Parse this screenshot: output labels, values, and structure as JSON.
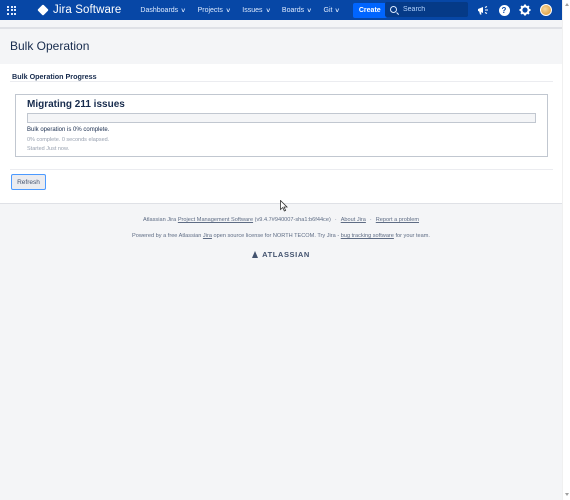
{
  "header": {
    "app_name": "Jira Software",
    "nav": [
      {
        "label": "Dashboards"
      },
      {
        "label": "Projects"
      },
      {
        "label": "Issues"
      },
      {
        "label": "Boards"
      },
      {
        "label": "Git"
      }
    ],
    "create_label": "Create",
    "search_placeholder": "Search",
    "icons": [
      "app-switcher-icon",
      "megaphone-icon",
      "help-icon",
      "settings-icon",
      "avatar"
    ],
    "brand_color": "#0747a6",
    "create_color": "#0065ff"
  },
  "page": {
    "title": "Bulk Operation"
  },
  "progress": {
    "section_title": "Bulk Operation Progress",
    "task_title": "Migrating 211 issues",
    "percent_complete": 0,
    "status": "Bulk operation is 0% complete.",
    "detail": "0% complete. 0 seconds elapsed.",
    "started": "Started Just now.",
    "refresh_label": "Refresh"
  },
  "footer": {
    "line1_prefix": "Atlassian Jira ",
    "line1_link": "Project Management Software",
    "line1_version": " (v9.4.7#940007-sha1:b6f44ce)",
    "about_link": "About Jira",
    "report_link": "Report a problem",
    "line2_prefix": "Powered by a free Atlassian ",
    "line2_jira_link": "Jira",
    "line2_middle": " open source license for NORTH TECOM. Try Jira - ",
    "line2_tracking_link": "bug tracking software",
    "line2_suffix": " for your team.",
    "logo_text": "ATLASSIAN"
  }
}
